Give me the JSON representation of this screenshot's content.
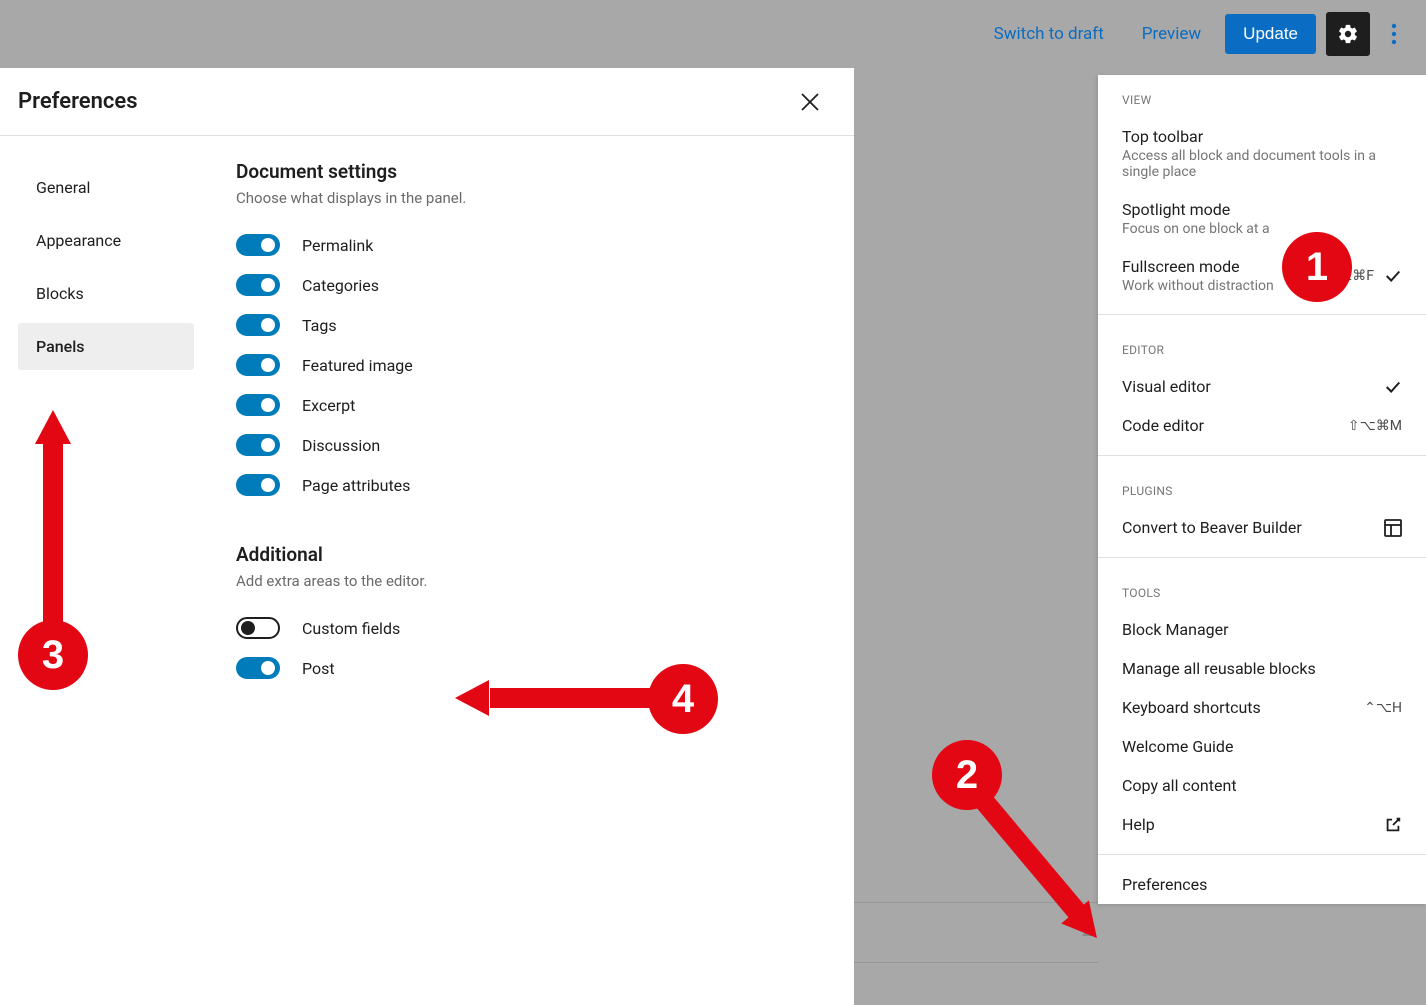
{
  "topbar": {
    "switch_draft": "Switch to draft",
    "preview": "Preview",
    "update": "Update"
  },
  "dropdown": {
    "section_view": "VIEW",
    "top_toolbar": {
      "label": "Top toolbar",
      "desc": "Access all block and document tools in a single place"
    },
    "spotlight": {
      "label": "Spotlight mode",
      "desc": "Focus on one block at a"
    },
    "fullscreen": {
      "label": "Fullscreen mode",
      "desc": "Work without distraction",
      "shortcut": "⌥⌘F"
    },
    "section_editor": "EDITOR",
    "visual_editor": "Visual editor",
    "code_editor": {
      "label": "Code editor",
      "shortcut": "⇧⌥⌘M"
    },
    "section_plugins": "PLUGINS",
    "beaver": "Convert to Beaver Builder",
    "section_tools": "TOOLS",
    "block_manager": "Block Manager",
    "reusable": "Manage all reusable blocks",
    "keyboard": {
      "label": "Keyboard shortcuts",
      "shortcut": "⌃⌥H"
    },
    "welcome": "Welcome Guide",
    "copy_all": "Copy all content",
    "help": "Help",
    "preferences": "Preferences"
  },
  "modal": {
    "title": "Preferences",
    "nav": {
      "general": "General",
      "appearance": "Appearance",
      "blocks": "Blocks",
      "panels": "Panels"
    },
    "doc_settings": {
      "title": "Document settings",
      "desc": "Choose what displays in the panel.",
      "items": {
        "permalink": "Permalink",
        "categories": "Categories",
        "tags": "Tags",
        "featured": "Featured image",
        "excerpt": "Excerpt",
        "discussion": "Discussion",
        "page_attrs": "Page attributes"
      }
    },
    "additional": {
      "title": "Additional",
      "desc": "Add extra areas to the editor.",
      "items": {
        "custom_fields": "Custom fields",
        "post": "Post"
      }
    }
  },
  "annotations": {
    "b1": "1",
    "b2": "2",
    "b3": "3",
    "b4": "4"
  }
}
